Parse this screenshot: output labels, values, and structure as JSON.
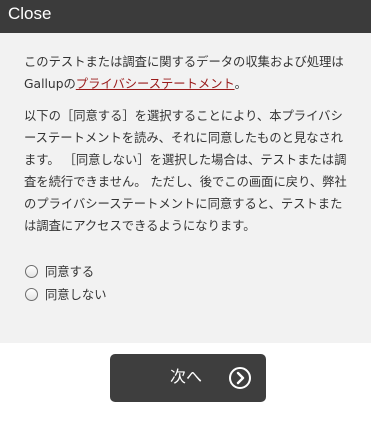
{
  "header": {
    "close_label": "Close"
  },
  "consent": {
    "intro_text": "このテストまたは調査に関するデータの収集および処理は",
    "intro_company": "Gallupの",
    "policy_link": "プライバシーステートメント",
    "intro_end": "。",
    "instructions": "以下の［同意する］を選択することにより、本プライバシーステートメントを読み、それに同意したものと見なされます。 ［同意しない］を選択した場合は、テストまたは調査を続行できません。 ただし、後でこの画面に戻り、弊社のプライバシーステートメントに同意すると、テストまたは調査にアクセスできるようになります。"
  },
  "options": {
    "agree_label": "同意する",
    "disagree_label": "同意しない"
  },
  "footer": {
    "next_label": "次へ"
  },
  "colors": {
    "header_bg": "#3b3b3b",
    "content_bg": "#f2f2f2",
    "link": "#9a1b1b",
    "button_bg": "#3e3e3e"
  },
  "icons": {
    "next": "chevron-right-circle-icon"
  }
}
